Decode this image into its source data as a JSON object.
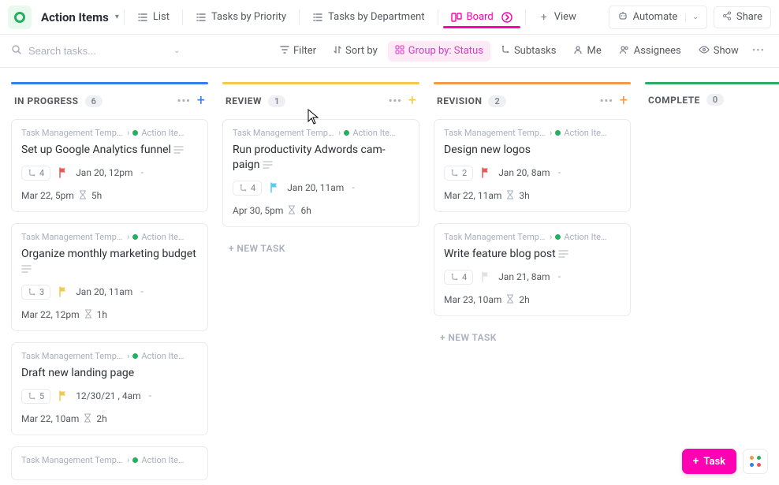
{
  "header": {
    "title": "Action Items",
    "views": {
      "list": "List",
      "priority": "Tasks by Priority",
      "department": "Tasks by Department",
      "board": "Board",
      "add_view": "View"
    },
    "automate": "Automate",
    "share": "Share"
  },
  "filterbar": {
    "search_placeholder": "Search tasks...",
    "filter": "Filter",
    "sort": "Sort by",
    "group": "Group by: Status",
    "subtasks": "Subtasks",
    "me": "Me",
    "assignees": "Assignees",
    "show": "Show"
  },
  "columns": [
    {
      "id": "in_progress",
      "title": "IN PROGRESS",
      "count": "6",
      "color": "#2f80ed",
      "plus_color": "#2f80ed",
      "cards": [
        {
          "breadcrumb1": "Task Management Templat...",
          "breadcrumb2": "Action Ite…",
          "title": "Set up Google Analytics funnel",
          "has_desc": true,
          "subtasks": "4",
          "flag_color": "#eb5757",
          "date": "Jan 20, 12pm",
          "date_dash": true,
          "time_label": "Mar 22, 5pm",
          "estimate": "5h"
        },
        {
          "breadcrumb1": "Task Management Templat...",
          "breadcrumb2": "Action Ite…",
          "title": "Organize monthly marketing budget",
          "has_desc": true,
          "subtasks": "3",
          "flag_color": "#f2c94c",
          "date": "Jan 20, 11am",
          "date_dash": true,
          "time_label": "Mar 22, 12pm",
          "estimate": "1h"
        },
        {
          "breadcrumb1": "Task Management Templat...",
          "breadcrumb2": "Action Ite…",
          "title": "Draft new landing page",
          "has_desc": false,
          "subtasks": "5",
          "flag_color": "#f2c94c",
          "date": "12/30/21 , 4am",
          "date_dash": true,
          "time_label": "Mar 22, 10am",
          "estimate": "2h"
        },
        {
          "breadcrumb1": "Task Management Templat...",
          "breadcrumb2": "Action Ite…",
          "title": "",
          "has_desc": false,
          "subtasks": "",
          "flag_color": "",
          "date": "",
          "date_dash": false,
          "time_label": "",
          "estimate": ""
        }
      ]
    },
    {
      "id": "review",
      "title": "REVIEW",
      "count": "1",
      "color": "#f2c94c",
      "plus_color": "#f2c94c",
      "cards": [
        {
          "breadcrumb1": "Task Management Templat...",
          "breadcrumb2": "Action Ite…",
          "title": "Run productivity Adwords cam­paign",
          "has_desc": true,
          "subtasks": "4",
          "flag_color": "#56ccf2",
          "date": "Jan 20, 11am",
          "date_dash": true,
          "time_label": "Apr 30, 5pm",
          "estimate": "6h"
        }
      ],
      "new_task_label": "+ NEW TASK"
    },
    {
      "id": "revision",
      "title": "REVISION",
      "count": "2",
      "color": "#f2994a",
      "plus_color": "#f2994a",
      "cards": [
        {
          "breadcrumb1": "Task Management Templat...",
          "breadcrumb2": "Action Ite…",
          "title": "Design new logos",
          "has_desc": false,
          "subtasks": "2",
          "flag_color": "#eb5757",
          "date": "Jan 20, 8am",
          "date_dash": true,
          "time_label": "Mar 22, 11am",
          "estimate": "3h"
        },
        {
          "breadcrumb1": "Task Management Templat...",
          "breadcrumb2": "Action Ite…",
          "title": "Write feature blog post",
          "has_desc": true,
          "subtasks": "4",
          "flag_color": "#e0e0e0",
          "date": "Jan 21, 8am",
          "date_dash": true,
          "time_label": "Mar 23, 10am",
          "estimate": "2h"
        }
      ],
      "new_task_label": "+ NEW TASK"
    },
    {
      "id": "complete",
      "title": "COMPLETE",
      "count": "0",
      "color": "#27ae60",
      "plus_color": "#27ae60",
      "cards": []
    }
  ],
  "fab": {
    "task": "Task"
  }
}
